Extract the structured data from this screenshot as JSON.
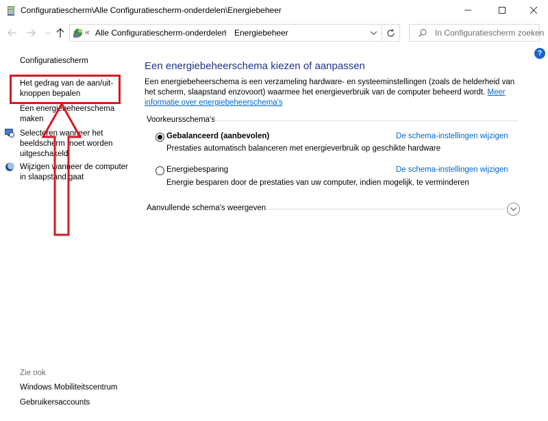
{
  "window": {
    "title": "Configuratiescherm\\Alle Configuratiescherm-onderdelen\\Energiebeheer"
  },
  "address": {
    "crumb_root": "Alle Configuratiescherm-onderdelen",
    "crumb_current": "Energiebeheer"
  },
  "search": {
    "placeholder": "In Configuratiescherm zoeken"
  },
  "help": {
    "label": "?"
  },
  "left_pane": {
    "home": "Configuratiescherm",
    "tasks": [
      "Het gedrag van de aan/uit-knoppen bepalen",
      "Een energiebeheerschema maken",
      "Selecteren wanneer het beeldscherm moet worden uitgeschakeld",
      "Wijzigen wanneer de computer in slaapstand gaat"
    ],
    "see_also_label": "Zie ook",
    "see_also": [
      "Windows Mobiliteitscentrum",
      "Gebruikersaccounts"
    ]
  },
  "main": {
    "title": "Een energiebeheerschema kiezen of aanpassen",
    "description": "Een energiebeheerschema is een verzameling hardware- en systeeminstellingen (zoals de helderheid van het scherm, slaapstand enzovoort) waarmee het energieverbruik van de computer beheerd wordt. ",
    "description_link": "Meer informatie over energiebeheerschema's",
    "group_label": "Voorkeursschema's",
    "plans": [
      {
        "name": "Gebalanceerd (aanbevolen)",
        "description": "Prestaties automatisch balanceren met energieverbruik op geschikte hardware",
        "link": "De schema-instellingen wijzigen",
        "selected": true
      },
      {
        "name": "Energiebesparing",
        "description": "Energie besparen door de prestaties van uw computer, indien mogelijk, te verminderen",
        "link": "De schema-instellingen wijzigen",
        "selected": false
      }
    ],
    "more_plans_label": "Aanvullende schema's weergeven"
  },
  "colors": {
    "title_blue": "#1e3287",
    "link_blue": "#0066cc",
    "annotation_red": "#d6181f"
  },
  "icons": [
    "power-options-icon",
    "back-arrow-icon",
    "forward-arrow-icon",
    "up-arrow-icon",
    "refresh-icon",
    "search-icon",
    "help-icon",
    "monitor-clock-icon",
    "moon-icon",
    "chevron-down-icon"
  ]
}
